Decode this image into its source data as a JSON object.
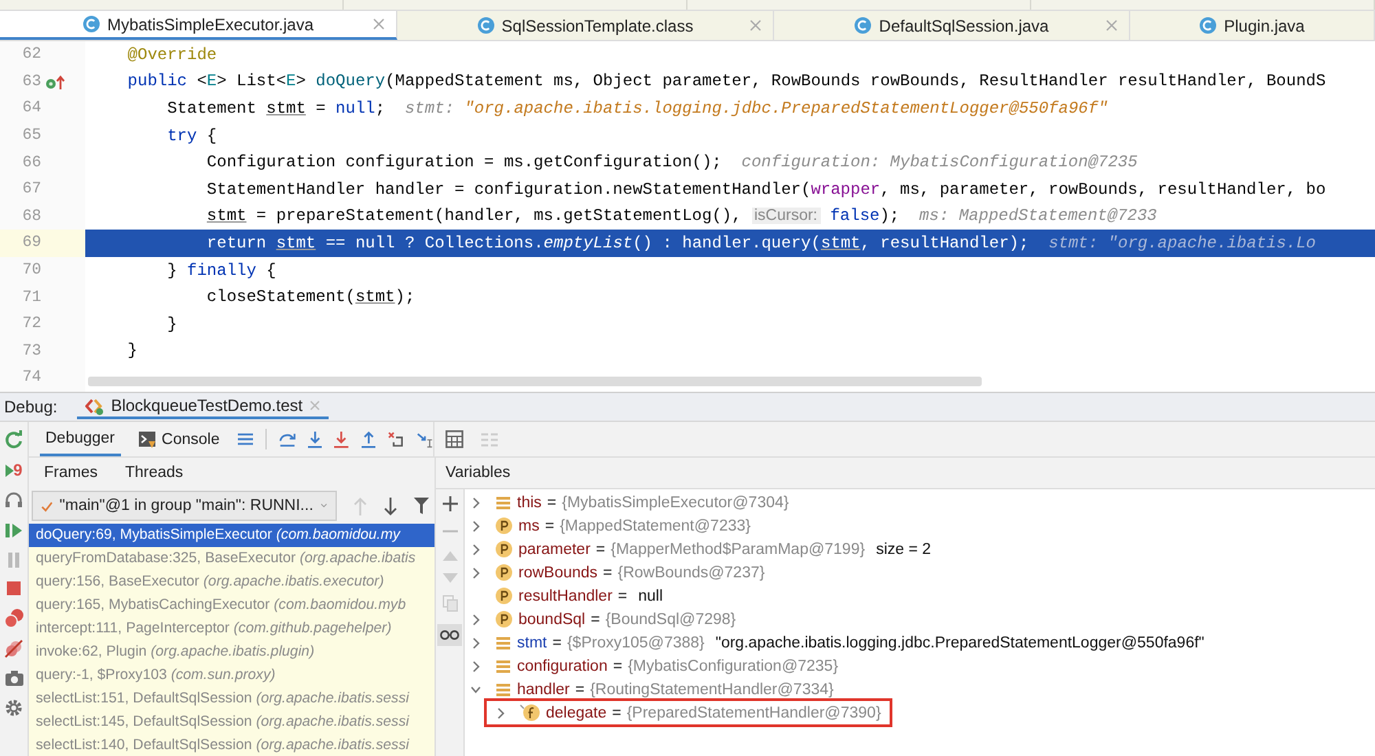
{
  "editor_tabs": [
    {
      "label": "MybatisSimpleExecutor.java",
      "selected": true,
      "closable": true
    },
    {
      "label": "SqlSessionTemplate.class",
      "selected": false,
      "closable": true
    },
    {
      "label": "DefaultSqlSession.java",
      "selected": false,
      "closable": true
    },
    {
      "label": "Plugin.java",
      "selected": false,
      "closable": false
    }
  ],
  "code": {
    "lines": [
      {
        "number": "62",
        "current": false,
        "tokens": [
          {
            "text": "    @Override",
            "kind": "annotation"
          }
        ]
      },
      {
        "number": "63",
        "current": false,
        "marker": true,
        "tokens": [
          {
            "text": "    public",
            "kind": "keyword"
          },
          {
            "text": " <",
            "kind": "plain"
          },
          {
            "text": "E",
            "kind": "typeparam"
          },
          {
            "text": "> List<",
            "kind": "plain"
          },
          {
            "text": "E",
            "kind": "typeparam"
          },
          {
            "text": "> ",
            "kind": "plain"
          },
          {
            "text": "doQuery",
            "kind": "method"
          },
          {
            "text": "(MappedStatement ms, Object parameter, RowBounds rowBounds, ResultHandler resultHandler, BoundS",
            "kind": "plain"
          }
        ]
      },
      {
        "number": "64",
        "current": false,
        "tokens": [
          {
            "text": "        Statement ",
            "kind": "plain"
          },
          {
            "text": "stmt",
            "kind": "var"
          },
          {
            "text": " = ",
            "kind": "plain"
          },
          {
            "text": "null",
            "kind": "keyword"
          },
          {
            "text": ";  ",
            "kind": "plain"
          },
          {
            "text": "stmt: ",
            "kind": "hint"
          },
          {
            "text": "\"org.apache.ibatis.logging.jdbc.PreparedStatementLogger@550fa96f\"",
            "kind": "hintstring"
          }
        ]
      },
      {
        "number": "65",
        "current": false,
        "tokens": [
          {
            "text": "        try",
            "kind": "keyword"
          },
          {
            "text": " {",
            "kind": "plain"
          }
        ]
      },
      {
        "number": "66",
        "current": false,
        "tokens": [
          {
            "text": "            Configuration configuration = ms.getConfiguration();  ",
            "kind": "plain"
          },
          {
            "text": "configuration: MybatisConfiguration@7235",
            "kind": "hint"
          }
        ]
      },
      {
        "number": "67",
        "current": false,
        "tokens": [
          {
            "text": "            StatementHandler handler = configuration.newStatementHandler(",
            "kind": "plain"
          },
          {
            "text": "wrapper",
            "kind": "field"
          },
          {
            "text": ", ms, parameter, rowBounds, resultHandler, bo",
            "kind": "plain"
          }
        ]
      },
      {
        "number": "68",
        "current": false,
        "tokens": [
          {
            "text": "            stmt",
            "kind": "var"
          },
          {
            "text": " = prepareStatement(handler, ms.getStatementLog(), ",
            "kind": "plain"
          },
          {
            "text": "isCursor:",
            "kind": "inlay"
          },
          {
            "text": " false",
            "kind": "keyword"
          },
          {
            "text": ");  ",
            "kind": "plain"
          },
          {
            "text": "ms: MappedStatement@7233",
            "kind": "hint"
          }
        ]
      },
      {
        "number": "69",
        "current": true,
        "tokens": [
          {
            "text": "            return ",
            "kind": "keyword"
          },
          {
            "text": "stmt",
            "kind": "var"
          },
          {
            "text": " == ",
            "kind": "plain"
          },
          {
            "text": "null",
            "kind": "keyword"
          },
          {
            "text": " ? Collections.",
            "kind": "plain"
          },
          {
            "text": "emptyList",
            "kind": "italic"
          },
          {
            "text": "() : handler.query(",
            "kind": "plain"
          },
          {
            "text": "stmt",
            "kind": "var"
          },
          {
            "text": ", resultHandler);  ",
            "kind": "plain"
          },
          {
            "text": "stmt: \"org.apache.ibatis.Lo",
            "kind": "hint"
          }
        ]
      },
      {
        "number": "70",
        "current": false,
        "tokens": [
          {
            "text": "        } ",
            "kind": "plain"
          },
          {
            "text": "finally",
            "kind": "keyword"
          },
          {
            "text": " {",
            "kind": "plain"
          }
        ]
      },
      {
        "number": "71",
        "current": false,
        "tokens": [
          {
            "text": "            closeStatement(",
            "kind": "plain"
          },
          {
            "text": "stmt",
            "kind": "var"
          },
          {
            "text": ");",
            "kind": "plain"
          }
        ]
      },
      {
        "number": "72",
        "current": false,
        "tokens": [
          {
            "text": "        }",
            "kind": "plain"
          }
        ]
      },
      {
        "number": "73",
        "current": false,
        "tokens": [
          {
            "text": "    }",
            "kind": "plain"
          }
        ]
      },
      {
        "number": "74",
        "current": false
      }
    ]
  },
  "debug": {
    "label": "Debug:",
    "session_tab": "BlockqueueTestDemo.test",
    "restart_badge": "9",
    "tabs": [
      {
        "label": "Debugger",
        "selected": true
      },
      {
        "label": "Console",
        "selected": false
      }
    ]
  },
  "frames": {
    "tabs": [
      "Frames",
      "Threads"
    ],
    "thread": "\"main\"@1 in group \"main\": RUNNI...",
    "items": [
      {
        "method": "doQuery:69, MybatisSimpleExecutor",
        "package": "(com.baomidou.my",
        "selected": true
      },
      {
        "method": "queryFromDatabase:325, BaseExecutor",
        "package": "(org.apache.ibatis",
        "selected": false
      },
      {
        "method": "query:156, BaseExecutor",
        "package": "(org.apache.ibatis.executor)",
        "selected": false
      },
      {
        "method": "query:165, MybatisCachingExecutor",
        "package": "(com.baomidou.myb",
        "selected": false
      },
      {
        "method": "intercept:111, PageInterceptor",
        "package": "(com.github.pagehelper)",
        "selected": false
      },
      {
        "method": "invoke:62, Plugin",
        "package": "(org.apache.ibatis.plugin)",
        "selected": false
      },
      {
        "method": "query:-1, $Proxy103",
        "package": "(com.sun.proxy)",
        "selected": false
      },
      {
        "method": "selectList:151, DefaultSqlSession",
        "package": "(org.apache.ibatis.sessi",
        "selected": false
      },
      {
        "method": "selectList:145, DefaultSqlSession",
        "package": "(org.apache.ibatis.sessi",
        "selected": false
      },
      {
        "method": "selectList:140, DefaultSqlSession",
        "package": "(org.apache.ibatis.sessi",
        "selected": false
      }
    ]
  },
  "variables": {
    "title": "Variables",
    "items": [
      {
        "kind": "local",
        "name": "this",
        "equals": "=",
        "value": "{MybatisSimpleExecutor@7304}",
        "expandable": true,
        "changed": false
      },
      {
        "kind": "param",
        "name": "ms",
        "equals": "=",
        "value": "{MappedStatement@7233}",
        "expandable": true,
        "changed": false
      },
      {
        "kind": "param",
        "name": "parameter",
        "equals": "=",
        "value": "{MapperMethod$ParamMap@7199}",
        "detail": "size = 2",
        "expandable": true,
        "changed": false
      },
      {
        "kind": "param",
        "name": "rowBounds",
        "equals": "=",
        "value": "{RowBounds@7237}",
        "expandable": true,
        "changed": false
      },
      {
        "kind": "param",
        "name": "resultHandler",
        "equals": "=",
        "detail": "null",
        "expandable": false,
        "changed": false
      },
      {
        "kind": "param",
        "name": "boundSql",
        "equals": "=",
        "value": "{BoundSql@7298}",
        "expandable": true,
        "changed": false
      },
      {
        "kind": "local",
        "name": "stmt",
        "equals": "=",
        "value": "{$Proxy105@7388}",
        "detail": "\"org.apache.ibatis.logging.jdbc.PreparedStatementLogger@550fa96f\"",
        "expandable": true,
        "changed": true
      },
      {
        "kind": "local",
        "name": "configuration",
        "equals": "=",
        "value": "{MybatisConfiguration@7235}",
        "expandable": true,
        "changed": false
      },
      {
        "kind": "local",
        "name": "handler",
        "equals": "=",
        "value": "{RoutingStatementHandler@7334}",
        "expandable": true,
        "expanded": true,
        "changed": false,
        "children": [
          {
            "kind": "field",
            "name": "delegate",
            "equals": "=",
            "value": "{PreparedStatementHandler@7390}",
            "expandable": true,
            "changed": false,
            "highlighted": true
          }
        ]
      }
    ]
  }
}
